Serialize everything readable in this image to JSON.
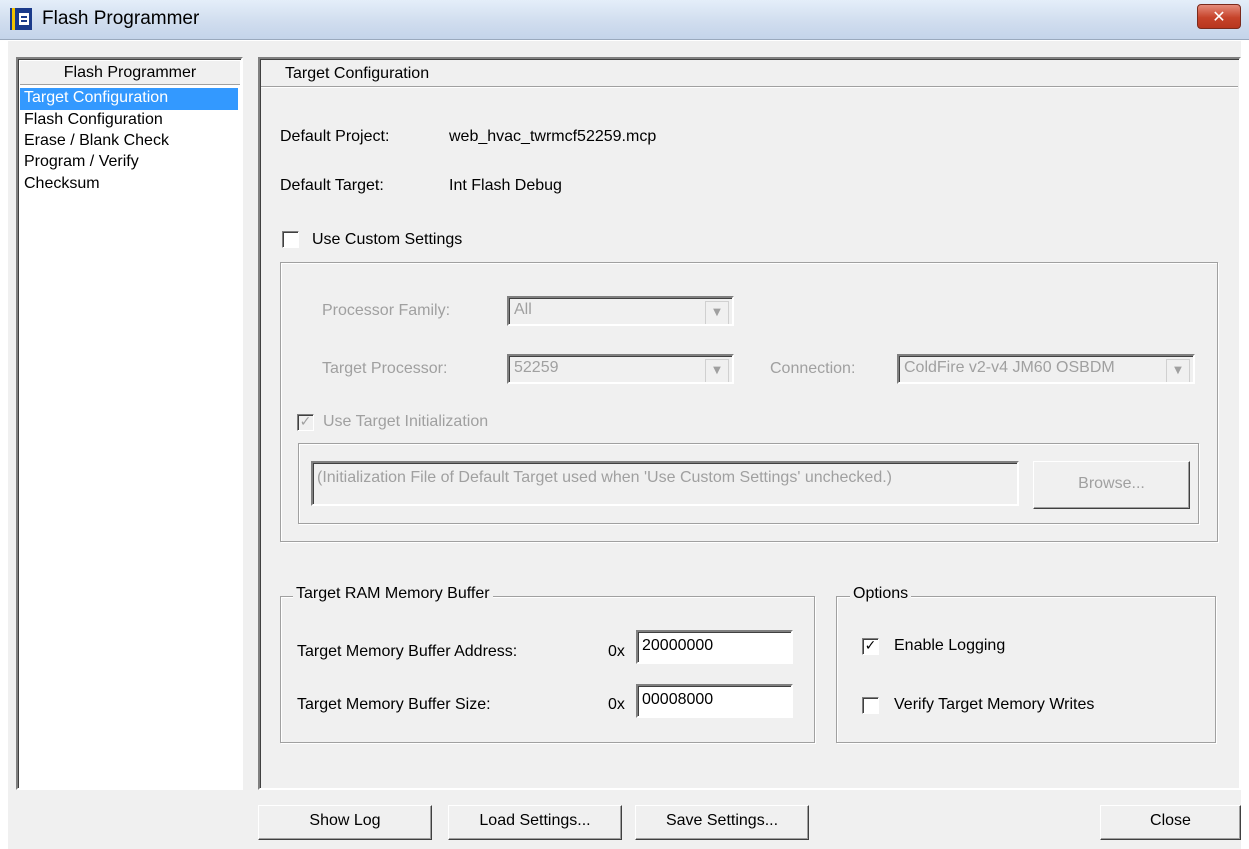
{
  "window": {
    "title": "Flash Programmer",
    "close_glyph": "✕"
  },
  "nav": {
    "header": "Flash Programmer",
    "items": [
      {
        "label": "Target Configuration",
        "selected": true
      },
      {
        "label": "Flash Configuration"
      },
      {
        "label": "Erase / Blank Check"
      },
      {
        "label": "Program / Verify"
      },
      {
        "label": "Checksum"
      }
    ]
  },
  "panel": {
    "title": "Target Configuration",
    "default_project_label": "Default Project:",
    "default_project_value": "web_hvac_twrmcf52259.mcp",
    "default_target_label": "Default Target:",
    "default_target_value": "Int Flash Debug",
    "use_custom_settings_label": "Use Custom Settings",
    "use_custom_settings_checked": false,
    "custom": {
      "processor_family_label": "Processor Family:",
      "processor_family_value": "All",
      "target_processor_label": "Target Processor:",
      "target_processor_value": "52259",
      "connection_label": "Connection:",
      "connection_value": "ColdFire v2-v4 JM60 OSBDM",
      "use_target_init_label": "Use Target Initialization",
      "use_target_init_checked": true,
      "init_file_text": "(Initialization File of Default Target used when 'Use Custom Settings' unchecked.)",
      "browse_label": "Browse..."
    },
    "ram_buffer": {
      "title": "Target RAM Memory Buffer",
      "address_label": "Target Memory Buffer Address:",
      "prefix": "0x",
      "address_value": "20000000",
      "size_label": "Target Memory Buffer Size:",
      "size_value": "00008000"
    },
    "options": {
      "title": "Options",
      "enable_logging_label": "Enable Logging",
      "enable_logging_checked": true,
      "verify_writes_label": "Verify Target Memory Writes",
      "verify_writes_checked": false
    }
  },
  "buttons": {
    "show_log": "Show Log",
    "load_settings": "Load Settings...",
    "save_settings": "Save Settings...",
    "close": "Close"
  },
  "glyphs": {
    "check": "✓",
    "combo_arrow": "▼"
  },
  "colors": {
    "selection": "#3399ff",
    "disabled_text": "#a0a0a0",
    "title_close": "#c6432a"
  }
}
